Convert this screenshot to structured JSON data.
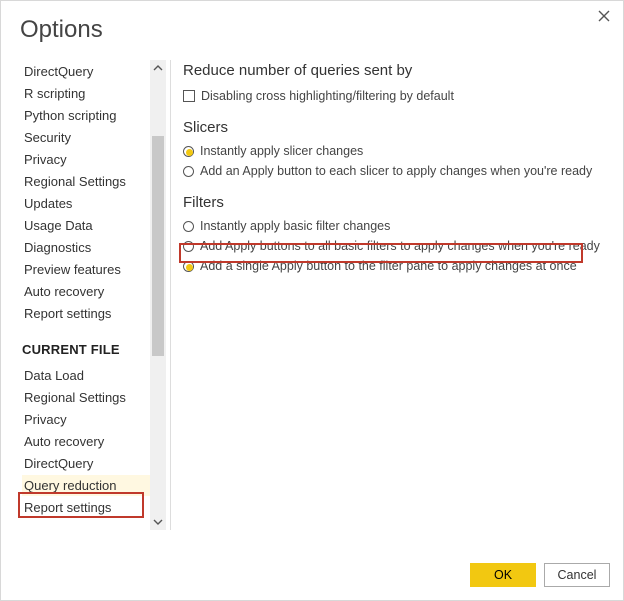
{
  "title": "Options",
  "close_icon": "close",
  "sidebar": {
    "section_label": "CURRENT FILE",
    "global_items": [
      {
        "label": "DirectQuery"
      },
      {
        "label": "R scripting"
      },
      {
        "label": "Python scripting"
      },
      {
        "label": "Security"
      },
      {
        "label": "Privacy"
      },
      {
        "label": "Regional Settings"
      },
      {
        "label": "Updates"
      },
      {
        "label": "Usage Data"
      },
      {
        "label": "Diagnostics"
      },
      {
        "label": "Preview features"
      },
      {
        "label": "Auto recovery"
      },
      {
        "label": "Report settings"
      }
    ],
    "file_items": [
      {
        "label": "Data Load"
      },
      {
        "label": "Regional Settings"
      },
      {
        "label": "Privacy"
      },
      {
        "label": "Auto recovery"
      },
      {
        "label": "DirectQuery"
      },
      {
        "label": "Query reduction",
        "selected": true
      },
      {
        "label": "Report settings"
      }
    ]
  },
  "content": {
    "section1_title": "Reduce number of queries sent by",
    "checkbox1": "Disabling cross highlighting/filtering by default",
    "slicers_title": "Slicers",
    "slicers_opts": [
      {
        "label": "Instantly apply slicer changes",
        "selected": true
      },
      {
        "label": "Add an Apply button to each slicer to apply changes when you're ready",
        "selected": false
      }
    ],
    "filters_title": "Filters",
    "filters_opts": [
      {
        "label": "Instantly apply basic filter changes",
        "selected": false
      },
      {
        "label": "Add Apply buttons to all basic filters to apply changes when you're ready",
        "selected": false
      },
      {
        "label": "Add a single Apply button to the filter pane to apply changes at once",
        "selected": true
      }
    ]
  },
  "buttons": {
    "ok": "OK",
    "cancel": "Cancel"
  }
}
